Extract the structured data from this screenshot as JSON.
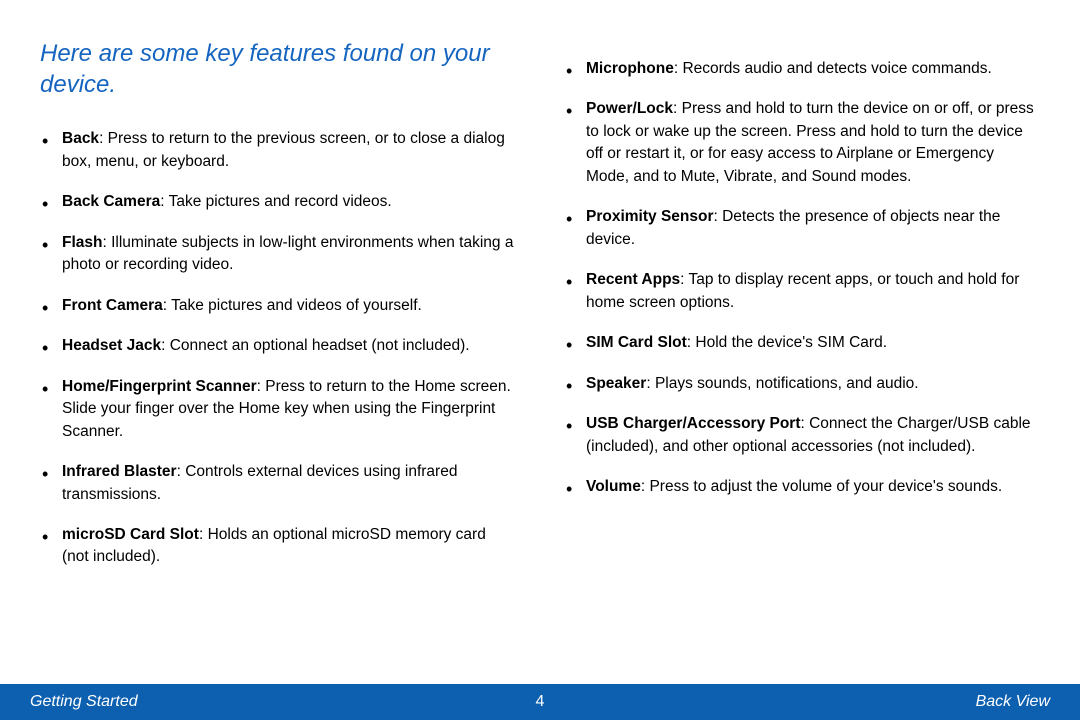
{
  "heading": "Here are some key features found on your device.",
  "left_features": [
    {
      "term": "Back",
      "desc": ": Press to return to the previous screen, or to close a dialog box, menu, or keyboard."
    },
    {
      "term": "Back Camera",
      "desc": ": Take pictures and record videos."
    },
    {
      "term": "Flash",
      "desc": ": Illuminate subjects in low-light environments when taking a photo or recording video."
    },
    {
      "term": "Front Camera",
      "desc": ": Take pictures and videos of yourself."
    },
    {
      "term": "Headset Jack",
      "desc": ": Connect an optional headset (not included)."
    },
    {
      "term": "Home/Fingerprint Scanner",
      "desc": ": Press to return to the Home screen. Slide your finger over the Home key when using the Fingerprint Scanner."
    },
    {
      "term": "Infrared Blaster",
      "desc": ": Controls external devices using infrared transmissions."
    },
    {
      "term": "microSD Card Slot",
      "desc": ": Holds an optional microSD memory card (not included)."
    }
  ],
  "right_features": [
    {
      "term": "Microphone",
      "desc": ": Records audio and detects voice commands."
    },
    {
      "term": "Power/Lock",
      "desc": ": Press and hold to turn the device on or off, or press to lock or wake up the screen. Press and hold to turn the device off or restart it, or for easy access to Airplane or Emergency Mode, and to Mute, Vibrate, and Sound modes."
    },
    {
      "term": "Proximity Sensor",
      "desc": ": Detects the presence of objects near the device."
    },
    {
      "term": "Recent Apps",
      "desc": ": Tap to display recent apps, or touch and hold for home screen options."
    },
    {
      "term": "SIM Card Slot",
      "desc": ": Hold the device's SIM Card."
    },
    {
      "term": "Speaker",
      "desc": ": Plays sounds, notifications, and audio."
    },
    {
      "term": "USB Charger/Accessory Port",
      "desc": ": Connect the Charger/USB cable (included), and other optional accessories (not included)."
    },
    {
      "term": "Volume",
      "desc": ": Press to adjust the volume of your device's sounds."
    }
  ],
  "footer": {
    "left": "Getting Started",
    "center": "4",
    "right": "Back View"
  }
}
